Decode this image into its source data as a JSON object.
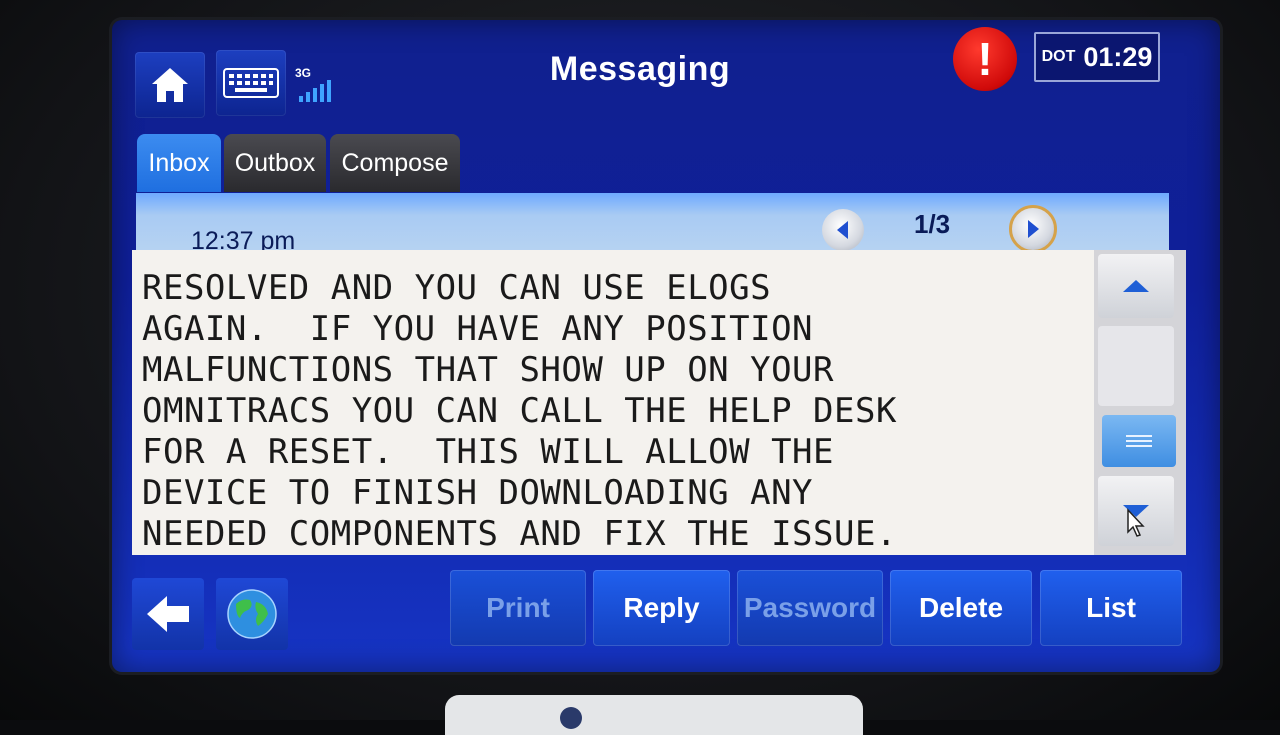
{
  "header": {
    "title": "Messaging",
    "network": "3G",
    "clock": {
      "prefix": "DOT",
      "time": "01:29"
    },
    "alert": "!"
  },
  "tabs": [
    {
      "label": "Inbox",
      "active": true
    },
    {
      "label": "Outbox",
      "active": false
    },
    {
      "label": "Compose",
      "active": false
    }
  ],
  "message": {
    "time": "12:37 pm",
    "page": "1/3",
    "lines": [
      "RESOLVED AND YOU CAN USE ELOGS",
      "AGAIN.  IF YOU HAVE ANY POSITION",
      "MALFUNCTIONS THAT SHOW UP ON YOUR",
      "OMNITRACS YOU CAN CALL THE HELP DESK",
      "FOR A RESET.  THIS WILL ALLOW THE",
      "DEVICE TO FINISH DOWNLOADING ANY",
      "NEEDED COMPONENTS AND FIX THE ISSUE."
    ]
  },
  "actions": {
    "print": "Print",
    "reply": "Reply",
    "password": "Password",
    "delete": "Delete",
    "list": "List"
  },
  "colors": {
    "screen": "#10208e",
    "tab_active": "#2a7ce8",
    "header_bar": "#bcd6f2",
    "button": "#1a50d8"
  }
}
